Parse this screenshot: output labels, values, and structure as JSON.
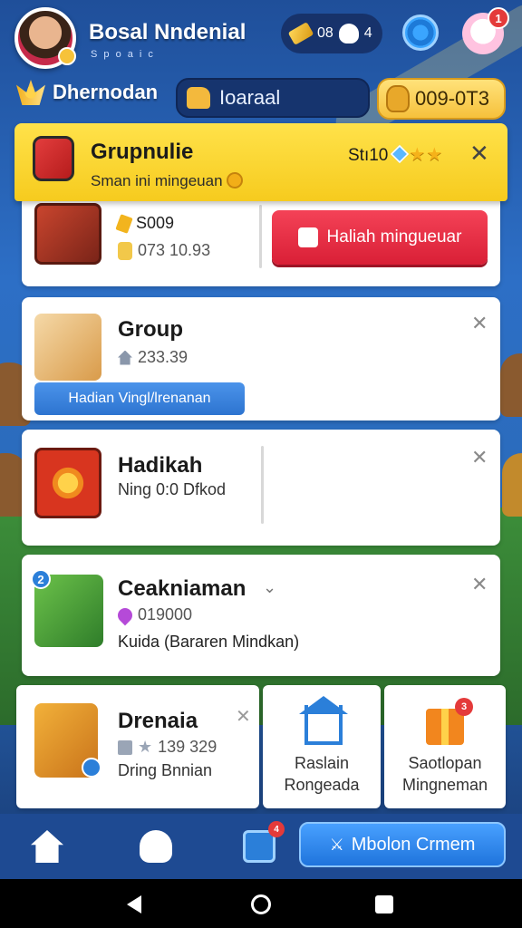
{
  "header": {
    "player_name": "Bosal Nndenial",
    "player_sub": "S p o a i c",
    "resources": {
      "gems": "08",
      "ghosts": "4"
    },
    "notification_count": "1",
    "level_label": "Dhernodan",
    "search_value": "Ioaraal",
    "coins": "009-0T3"
  },
  "banner": {
    "title": "Grupnulie",
    "subtitle": "Sman ini mingeuan",
    "score": "Stı10"
  },
  "cards": {
    "first": {
      "line1": "S009",
      "line2": "073 10.93",
      "button_label": "Haliah mingueuar"
    },
    "group": {
      "title": "Group",
      "count": "233.39",
      "button_label": "Hadian Vingl/lrenanan"
    },
    "hadikah": {
      "title": "Hadikah",
      "subtitle": "Ning 0:0 Dfkod"
    },
    "ceakniaman": {
      "title": "Ceakniaman",
      "value": "019000",
      "subtitle": "Kuida (Bararen Mindkan)",
      "badge_num": "2"
    }
  },
  "bottom_cards": {
    "drenaia": {
      "title": "Drenaia",
      "stats": "139 329",
      "subtitle": "Dring Bnnian"
    },
    "house": {
      "line1": "Raslain",
      "line2": "Rongeada"
    },
    "gift": {
      "line1": "Saotlopan",
      "line2": "Mingneman",
      "badge": "3"
    }
  },
  "nav": {
    "cam_badge": "4",
    "cta_label": "Mbolon Crmem"
  },
  "colors": {
    "banner": "#f6cb1e",
    "red_button": "#e02a40",
    "blue_button": "#2d74d0",
    "nav_bg": "#1e4a92"
  }
}
